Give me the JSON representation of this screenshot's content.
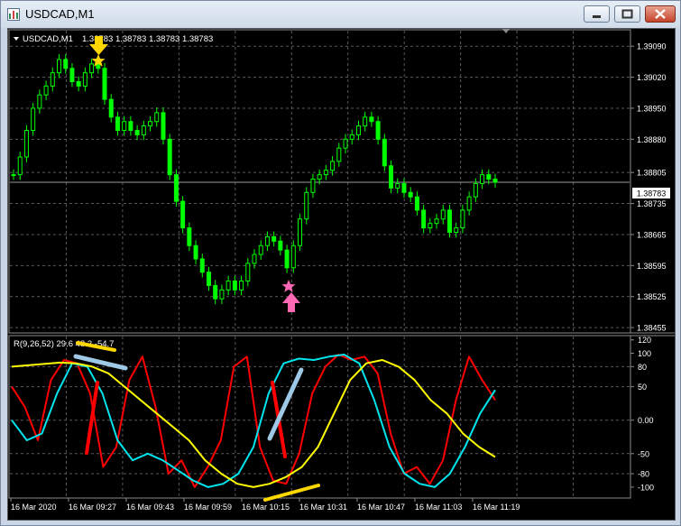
{
  "window": {
    "title": "USDCAD,M1",
    "title_color": "#000000"
  },
  "header": {
    "symbol_label": "USDCAD,M1",
    "ohlc": "1.38783 1.38783 1.38783 1.38783"
  },
  "price_axis": {
    "ticks": [
      "1.39090",
      "1.39020",
      "1.38950",
      "1.38880",
      "1.38805",
      "1.38735",
      "1.38665",
      "1.38595",
      "1.38525",
      "1.38455"
    ],
    "current_price": "1.38783"
  },
  "indicator": {
    "label": "R(9,26,52) 29.6 48.3 -54.7",
    "ticks": [
      "120",
      "100",
      "80",
      "50",
      "0.00",
      "-50",
      "-80",
      "-100"
    ]
  },
  "time_axis": {
    "labels": [
      "16 Mar 2020",
      "16 Mar 09:27",
      "16 Mar 09:43",
      "16 Mar 09:59",
      "16 Mar 10:15",
      "16 Mar 10:31",
      "16 Mar 10:47",
      "16 Mar 11:03",
      "16 Mar 11:19"
    ]
  },
  "colors": {
    "background": "#000000",
    "candles": "#00ff00",
    "grid": "#5a5a5a",
    "axis_text": "#ffffff",
    "line_fast": "#ff0000",
    "line_mid": "#00e5ee",
    "line_slow": "#ffff00",
    "buy_marker": "#ff69b4",
    "sell_marker": "#ffd700"
  },
  "markers": {
    "sell": "sell-arrow-star",
    "buy": "buy-arrow-star"
  },
  "chart_data": {
    "type": "line",
    "price": {
      "close": [
        1.388,
        1.3884,
        1.389,
        1.3895,
        1.3898,
        1.39,
        1.3903,
        1.3906,
        1.3904,
        1.3901,
        1.39,
        1.3903,
        1.3905,
        1.3904,
        1.3897,
        1.3893,
        1.389,
        1.3892,
        1.389,
        1.3889,
        1.3891,
        1.3892,
        1.3894,
        1.3888,
        1.388,
        1.3874,
        1.3868,
        1.3864,
        1.3861,
        1.3858,
        1.3855,
        1.3852,
        1.3854,
        1.3856,
        1.3854,
        1.3856,
        1.386,
        1.3862,
        1.3864,
        1.3866,
        1.3865,
        1.3863,
        1.3859,
        1.3864,
        1.387,
        1.3876,
        1.3879,
        1.388,
        1.3881,
        1.3883,
        1.3886,
        1.3888,
        1.3889,
        1.3891,
        1.3893,
        1.3892,
        1.3888,
        1.3882,
        1.3877,
        1.3878,
        1.3876,
        1.3875,
        1.3872,
        1.3868,
        1.3869,
        1.387,
        1.3872,
        1.3867,
        1.3868,
        1.3872,
        1.3875,
        1.3878,
        1.388,
        1.3879,
        1.38783
      ],
      "y_range": [
        1.38445,
        1.39125
      ]
    },
    "indicator": {
      "label": "R(9,26,52)",
      "values": {
        "fast": 29.6,
        "mid": 48.3,
        "slow": -54.7
      },
      "y_range": [
        -115,
        125
      ],
      "series": [
        {
          "values": [
            50,
            20,
            -30,
            60,
            90,
            85,
            40,
            -70,
            -40,
            60,
            95,
            20,
            -80,
            -60,
            -100,
            -70,
            -30,
            80,
            95,
            -40,
            -90,
            -95,
            -50,
            40,
            80,
            98,
            90,
            95,
            70,
            -20,
            -80,
            -70,
            -95,
            -60,
            30,
            95,
            60,
            30
          ]
        },
        {
          "values": [
            0,
            -30,
            -20,
            40,
            85,
            80,
            40,
            -30,
            -60,
            -50,
            -60,
            -75,
            -90,
            -100,
            -95,
            -80,
            -40,
            40,
            85,
            92,
            90,
            95,
            98,
            85,
            30,
            -40,
            -80,
            -95,
            -100,
            -80,
            -40,
            10,
            45
          ]
        },
        {
          "values": [
            80,
            82,
            84,
            86,
            85,
            80,
            70,
            50,
            30,
            10,
            -10,
            -30,
            -60,
            -80,
            -95,
            -100,
            -95,
            -85,
            -70,
            -40,
            10,
            60,
            85,
            90,
            80,
            60,
            30,
            10,
            -20,
            -40,
            -55
          ]
        }
      ]
    }
  }
}
